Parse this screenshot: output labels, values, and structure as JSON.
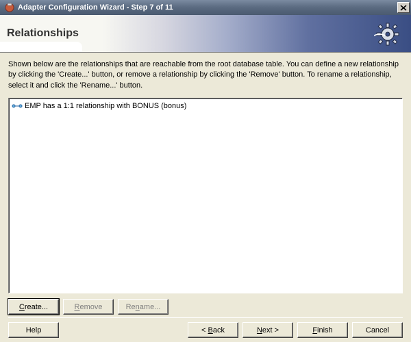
{
  "window": {
    "title": "Adapter Configuration Wizard - Step 7 of 11"
  },
  "header": {
    "title": "Relationships"
  },
  "description_text": "Shown below are the relationships that are reachable from the root database table.  You can define a new relationship by clicking the 'Create...' button, or remove a relationship by clicking the 'Remove' button.  To rename a relationship, select it and click the 'Rename...' button.",
  "tree": {
    "items": [
      {
        "label": "EMP has a 1:1 relationship with BONUS (bonus)"
      }
    ]
  },
  "buttons": {
    "create": "Create...",
    "remove": "Remove",
    "rename": "Rename...",
    "help": "Help",
    "back": "< Back",
    "next": "Next >",
    "finish": "Finish",
    "cancel": "Cancel"
  },
  "state": {
    "remove_enabled": false,
    "rename_enabled": false
  }
}
